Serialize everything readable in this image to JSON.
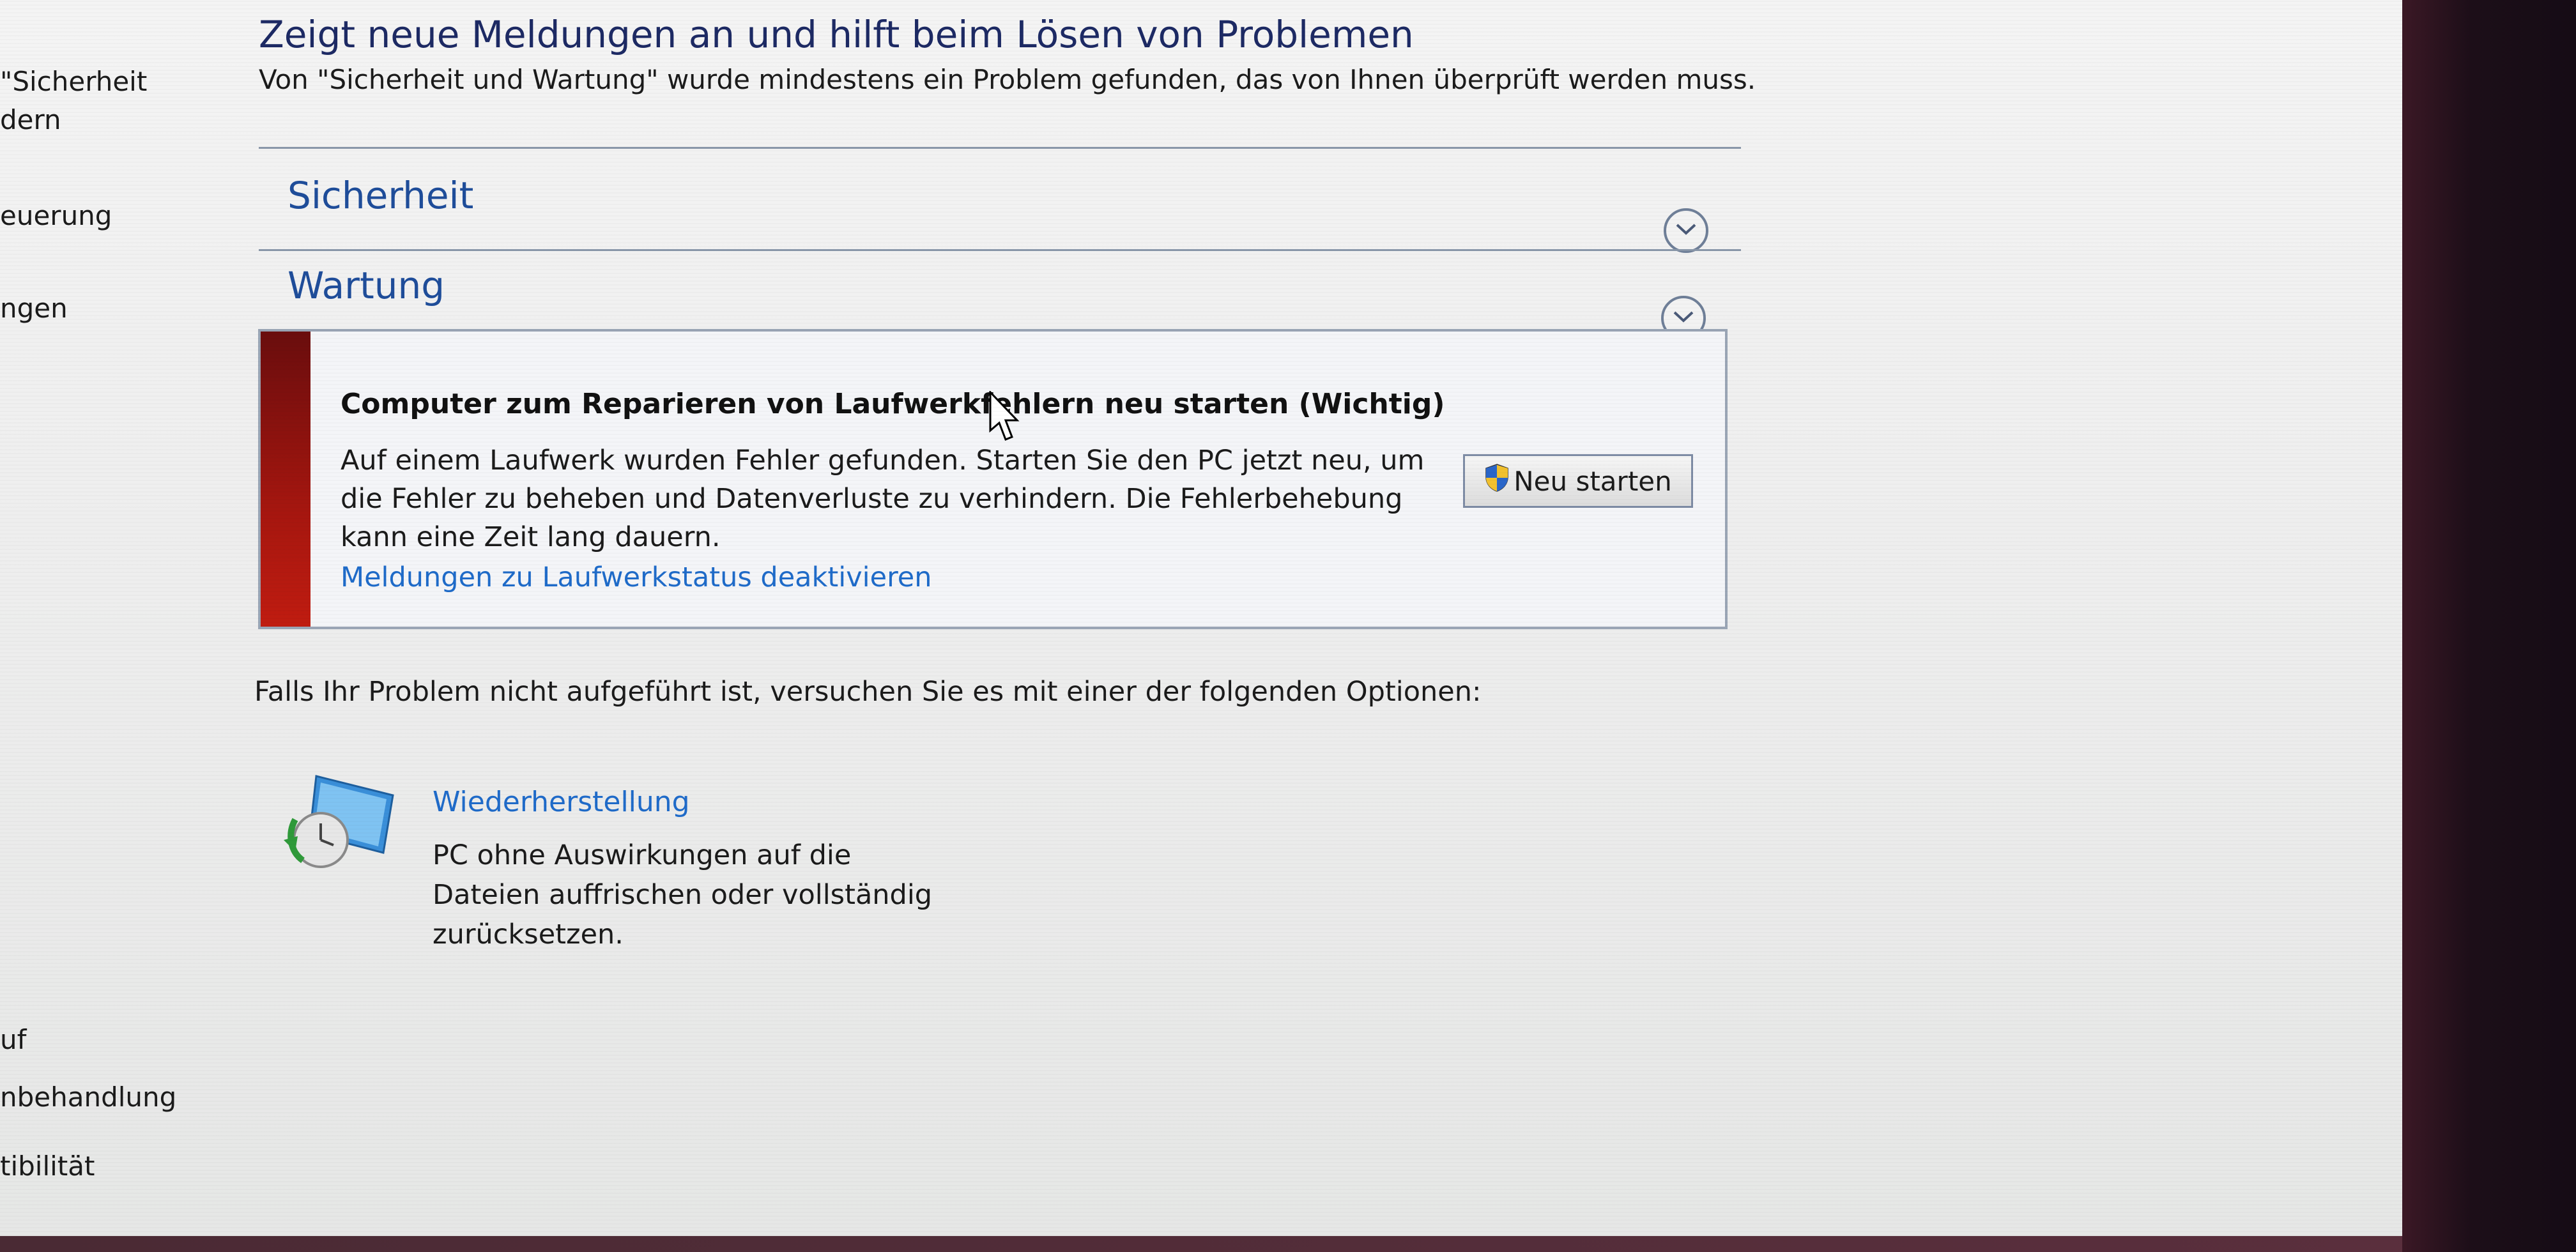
{
  "left_nav": {
    "items": [
      "\"Sicherheit",
      "dern",
      "euerung",
      "ngen",
      "uf",
      "nbehandlung",
      "tibilität"
    ]
  },
  "help": {
    "label": "?"
  },
  "header": {
    "title": "Zeigt neue Meldungen an und hilft beim Lösen von Problemen",
    "subtitle": "Von \"Sicherheit und Wartung\" wurde mindestens ein Problem gefunden, das von Ihnen überprüft werden muss."
  },
  "sections": {
    "security": {
      "title": "Sicherheit"
    },
    "maintenance": {
      "title": "Wartung"
    }
  },
  "alert": {
    "title": "Computer zum Reparieren von Laufwerkfehlern neu starten  (Wichtig)",
    "body": "Auf einem Laufwerk wurden Fehler gefunden. Starten Sie den PC jetzt neu, um die Fehler zu beheben und Datenverluste zu verhindern. Die Fehlerbehebung kann eine Zeit lang dauern.",
    "link": "Meldungen zu Laufwerkstatus deaktivieren",
    "button": "Neu starten"
  },
  "options": {
    "intro": "Falls Ihr Problem nicht aufgeführt ist, versuchen Sie es mit einer der folgenden Optionen:",
    "recovery": {
      "title": "Wiederherstellung",
      "description": "PC ohne Auswirkungen auf die Dateien auffrischen oder vollständig zurücksetzen."
    }
  },
  "colors": {
    "heading": "#1d2a64",
    "link": "#1f6bc9",
    "section_title": "#1f4d9a",
    "alert_bar": "#a5160f"
  }
}
